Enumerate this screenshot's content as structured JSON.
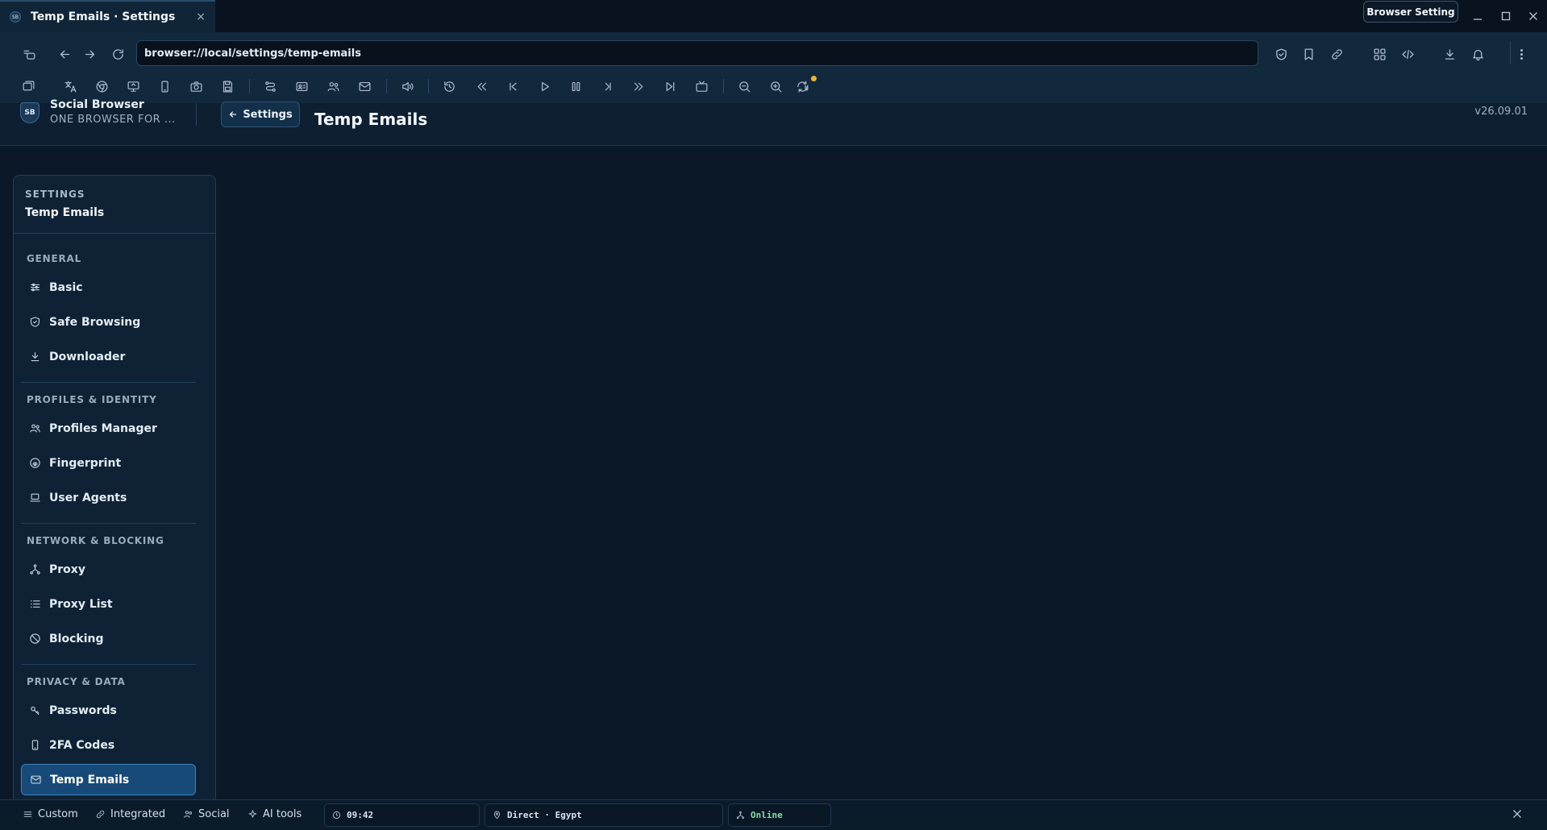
{
  "tab": {
    "title": "Temp Emails · Settings",
    "favicon": "SB",
    "close": "×"
  },
  "window": {
    "setting_button": "Browser Setting"
  },
  "address_bar": {
    "url": "browser://local/settings/temp-emails"
  },
  "header": {
    "brand_logo": "SB",
    "brand_name": "Social Browser",
    "brand_tagline": "ONE BROWSER FOR ...",
    "back_label": "Settings",
    "page_title": "Temp Emails",
    "version": "v26.09.01"
  },
  "sidebar": {
    "eyebrow": "SETTINGS",
    "current": "Temp Emails",
    "sections": [
      {
        "title": "GENERAL",
        "items": [
          {
            "label": "Basic",
            "icon": "sliders-icon"
          },
          {
            "label": "Safe Browsing",
            "icon": "shield-icon"
          },
          {
            "label": "Downloader",
            "icon": "download-icon"
          }
        ]
      },
      {
        "title": "PROFILES & IDENTITY",
        "items": [
          {
            "label": "Profiles Manager",
            "icon": "users-icon"
          },
          {
            "label": "Fingerprint",
            "icon": "fingerprint-icon"
          },
          {
            "label": "User Agents",
            "icon": "laptop-icon"
          }
        ]
      },
      {
        "title": "NETWORK & BLOCKING",
        "items": [
          {
            "label": "Proxy",
            "icon": "network-icon"
          },
          {
            "label": "Proxy List",
            "icon": "list-icon"
          },
          {
            "label": "Blocking",
            "icon": "block-icon"
          }
        ]
      },
      {
        "title": "PRIVACY & DATA",
        "items": [
          {
            "label": "Passwords",
            "icon": "key-icon"
          },
          {
            "label": "2FA Codes",
            "icon": "phone-icon"
          },
          {
            "label": "Temp Emails",
            "icon": "mail-icon",
            "active": true
          }
        ]
      }
    ]
  },
  "statusbar": {
    "custom": "Custom",
    "integrated": "Integrated",
    "social": "Social",
    "ai_tools": "AI tools",
    "time": "09:42",
    "connection": "Direct · Egypt",
    "network_status": "Online"
  },
  "colors": {
    "accent": "#174a78",
    "accent_border": "#3d82c0",
    "background": "#0a1828",
    "online": "#7fe0a3",
    "notify": "#f0b429"
  }
}
